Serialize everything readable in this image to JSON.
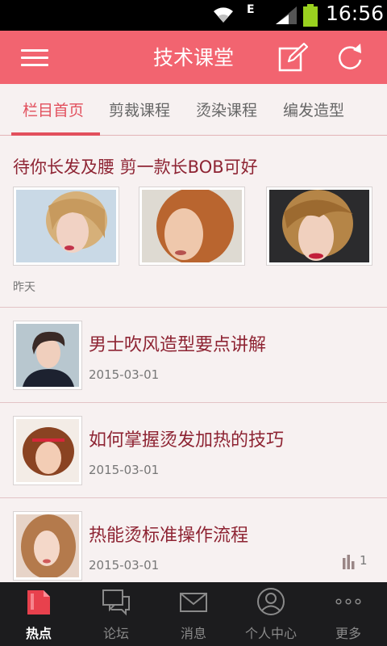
{
  "status_bar": {
    "network_type": "E",
    "time": "16:56"
  },
  "header": {
    "title": "技术课堂",
    "menu_icon": "menu-icon",
    "edit_icon": "edit-icon",
    "refresh_icon": "refresh-icon",
    "background": "#f26470"
  },
  "tabs": [
    {
      "label": "栏目首页",
      "active": true
    },
    {
      "label": "剪裁课程",
      "active": false
    },
    {
      "label": "烫染课程",
      "active": false
    },
    {
      "label": "编发造型",
      "active": false
    }
  ],
  "feature": {
    "title": "待你长发及腰 剪一款长BOB可好",
    "time": "昨天",
    "images": [
      "photo-thumbnail",
      "photo-thumbnail",
      "photo-thumbnail"
    ]
  },
  "list": [
    {
      "title": "男士吹风造型要点讲解",
      "date": "2015-03-01",
      "stat": ""
    },
    {
      "title": "如何掌握烫发加热的技巧",
      "date": "2015-03-01",
      "stat": ""
    },
    {
      "title": "热能烫标准操作流程",
      "date": "2015-03-01",
      "stat": "1"
    }
  ],
  "bottom_nav": [
    {
      "label": "热点",
      "icon": "hot-document-icon",
      "active": true
    },
    {
      "label": "论坛",
      "icon": "forum-chat-icon",
      "active": false
    },
    {
      "label": "消息",
      "icon": "message-envelope-icon",
      "active": false
    },
    {
      "label": "个人中心",
      "icon": "user-profile-icon",
      "active": false
    },
    {
      "label": "更多",
      "icon": "more-dots-icon",
      "active": false
    }
  ],
  "colors": {
    "accent": "#e2505d",
    "title_text": "#8e2433",
    "nav_background": "#1c1c1e"
  }
}
